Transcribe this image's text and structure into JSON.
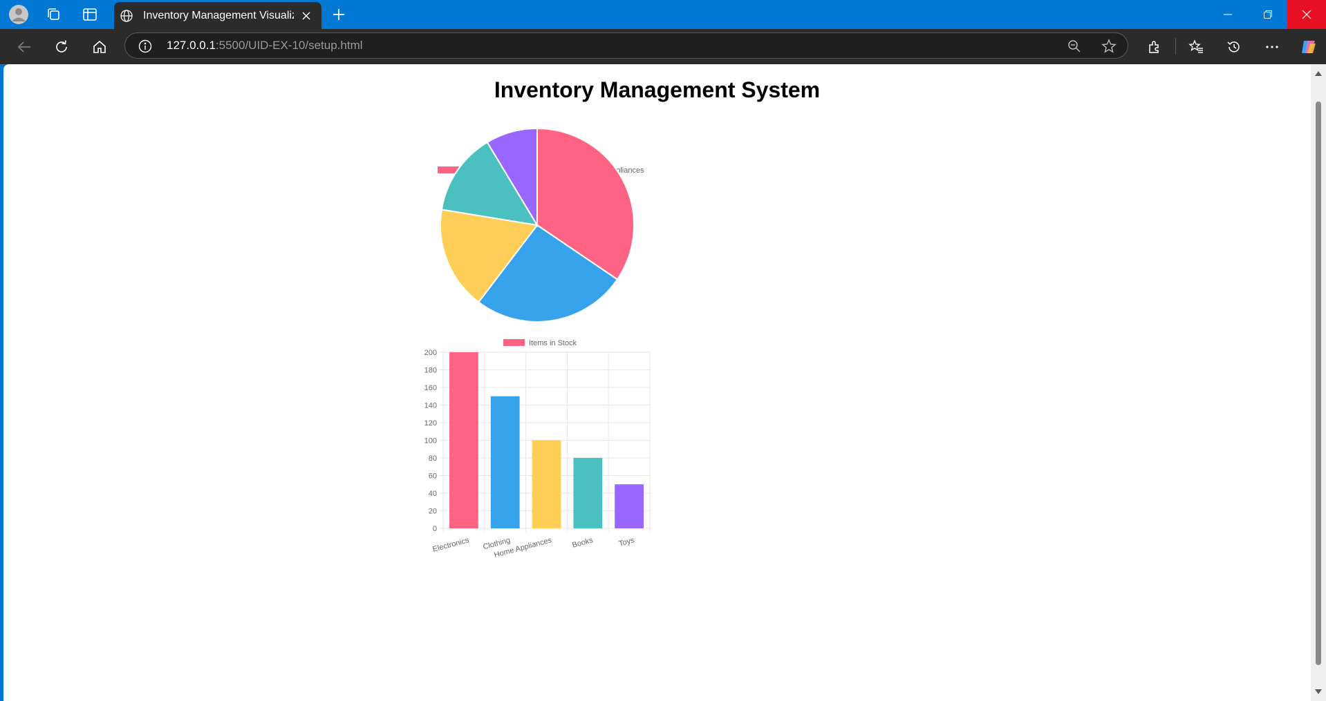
{
  "browser": {
    "tab_title": "Inventory Management Visualizat",
    "url_host": "127.0.0.1",
    "url_path": ":5500/UID-EX-10/setup.html"
  },
  "page": {
    "title": "Inventory Management System"
  },
  "colors": {
    "red": "#ff6384",
    "blue": "#36a2eb",
    "yellow": "#ffce56",
    "teal": "#4bc0c0",
    "purple": "#9966ff"
  },
  "chart_data": [
    {
      "type": "pie",
      "categories": [
        "Electronics",
        "Clothing",
        "Home Appliances",
        "Books",
        "Toys"
      ],
      "values": [
        200,
        150,
        100,
        80,
        50
      ],
      "legend": "top",
      "colors": [
        "#ff6384",
        "#36a2eb",
        "#ffce56",
        "#4bc0c0",
        "#9966ff"
      ]
    },
    {
      "type": "bar",
      "categories": [
        "Electronics",
        "Clothing",
        "Home Appliances",
        "Books",
        "Toys"
      ],
      "series": [
        {
          "name": "Items in Stock",
          "values": [
            200,
            150,
            100,
            80,
            50
          ]
        }
      ],
      "ylim": [
        0,
        200
      ],
      "yticks": [
        0,
        20,
        40,
        60,
        80,
        100,
        120,
        140,
        160,
        180,
        200
      ],
      "grid": true,
      "legend": "top",
      "colors": [
        "#ff6384",
        "#36a2eb",
        "#ffce56",
        "#4bc0c0",
        "#9966ff"
      ]
    }
  ]
}
